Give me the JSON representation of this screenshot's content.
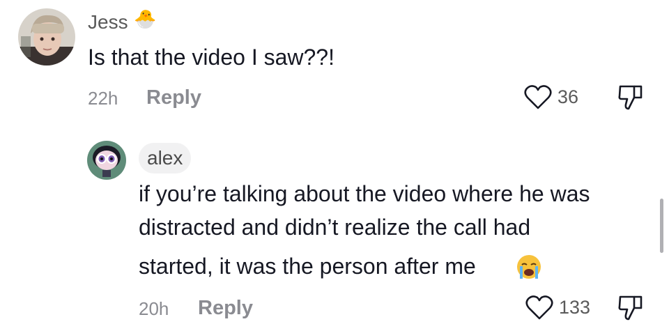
{
  "comments": [
    {
      "author": "Jess",
      "author_badge_icon": "hatching-chick-icon",
      "text": "Is that the video I saw??!",
      "time": "22h",
      "reply_label": "Reply",
      "likes": "36"
    }
  ],
  "reply": {
    "author": "alex",
    "text_line1": "if you’re talking about the video where he was",
    "text_line2": "distracted and didn’t realize the call had",
    "text_line3": "started, it was the person after me",
    "emoji_icon": "loudly-crying-face-icon",
    "time": "20h",
    "reply_label": "Reply",
    "likes": "133"
  }
}
